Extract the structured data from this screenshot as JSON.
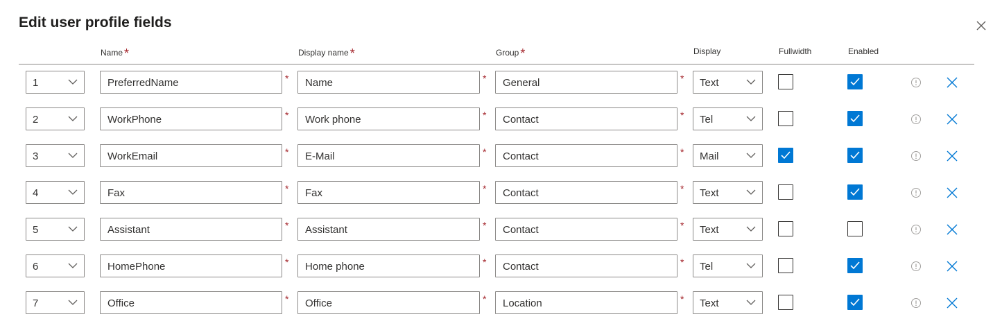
{
  "dialog": {
    "title": "Edit user profile fields"
  },
  "columns": {
    "name": "Name",
    "display_name": "Display name",
    "group": "Group",
    "display": "Display",
    "fullwidth": "Fullwidth",
    "enabled": "Enabled"
  },
  "required_mark": "*",
  "colors": {
    "accent": "#0078d4",
    "required": "#a4262c",
    "border": "#8a8886"
  },
  "icons": {
    "close": "close-icon",
    "info": "info-icon",
    "delete": "delete-icon",
    "dropdown": "chevron-down-icon",
    "check": "checkmark-icon"
  },
  "rows": [
    {
      "order": "1",
      "name": "PreferredName",
      "display_name": "Name",
      "group": "General",
      "display": "Text",
      "fullwidth": false,
      "enabled": true
    },
    {
      "order": "2",
      "name": "WorkPhone",
      "display_name": "Work phone",
      "group": "Contact",
      "display": "Tel",
      "fullwidth": false,
      "enabled": true
    },
    {
      "order": "3",
      "name": "WorkEmail",
      "display_name": "E-Mail",
      "group": "Contact",
      "display": "Mail",
      "fullwidth": true,
      "enabled": true
    },
    {
      "order": "4",
      "name": "Fax",
      "display_name": "Fax",
      "group": "Contact",
      "display": "Text",
      "fullwidth": false,
      "enabled": true
    },
    {
      "order": "5",
      "name": "Assistant",
      "display_name": "Assistant",
      "group": "Contact",
      "display": "Text",
      "fullwidth": false,
      "enabled": false
    },
    {
      "order": "6",
      "name": "HomePhone",
      "display_name": "Home phone",
      "group": "Contact",
      "display": "Tel",
      "fullwidth": false,
      "enabled": true
    },
    {
      "order": "7",
      "name": "Office",
      "display_name": "Office",
      "group": "Location",
      "display": "Text",
      "fullwidth": false,
      "enabled": true
    }
  ]
}
